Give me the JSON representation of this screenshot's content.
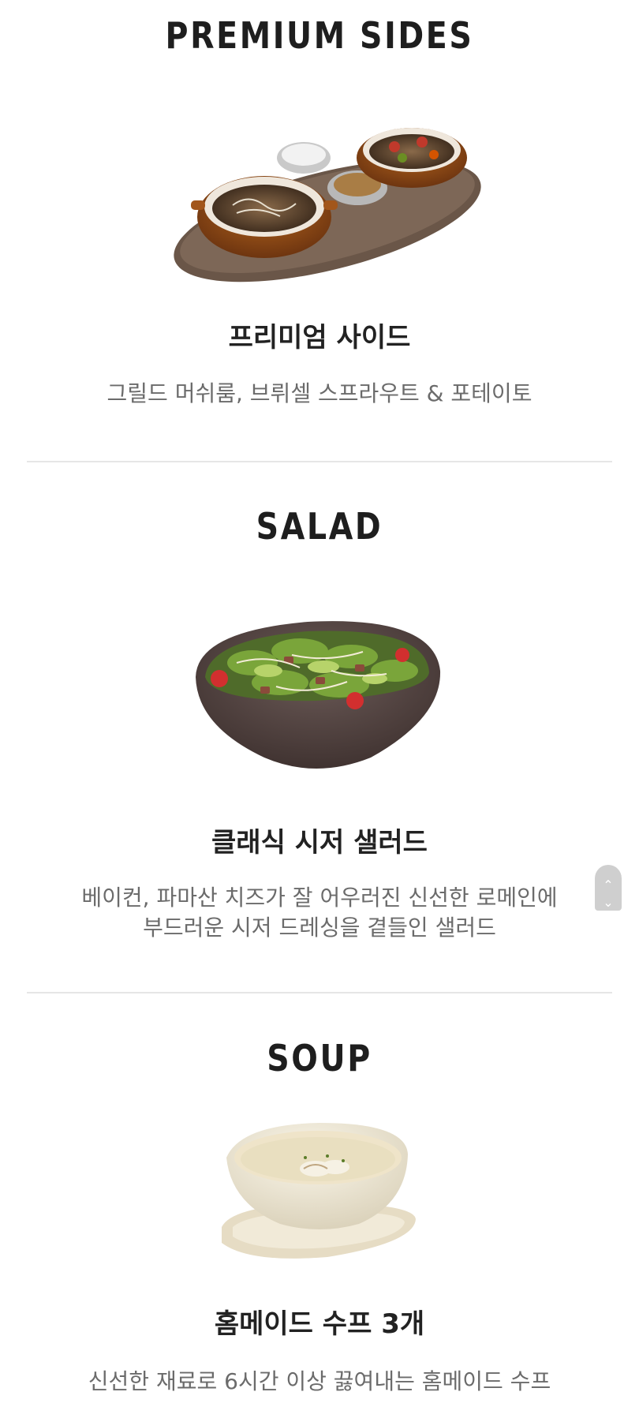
{
  "sections": [
    {
      "title": "PREMIUM SIDES",
      "item_name": "프리미엄 사이드",
      "description_lines": [
        "그릴드 머쉬룸, 브뤼셀 스프라우트 & 포테이토"
      ],
      "image_icon": "premium-sides-platter-image"
    },
    {
      "title": "SALAD",
      "item_name": "클래식 시저 샐러드",
      "description_lines": [
        "베이컨, 파마산 치즈가 잘 어우러진 신선한 로메인에",
        "부드러운 시저 드레싱을 곁들인 샐러드"
      ],
      "image_icon": "caesar-salad-bowl-image"
    },
    {
      "title": "SOUP",
      "item_name": "홈메이드 수프 3개",
      "description_lines": [
        "신선한 재료로 6시간 이상 끓여내는 홈메이드 수프"
      ],
      "image_icon": "mushroom-soup-bowl-image"
    }
  ],
  "scroll_widget": {
    "up_glyph": "⌃",
    "down_glyph": "⌄"
  }
}
